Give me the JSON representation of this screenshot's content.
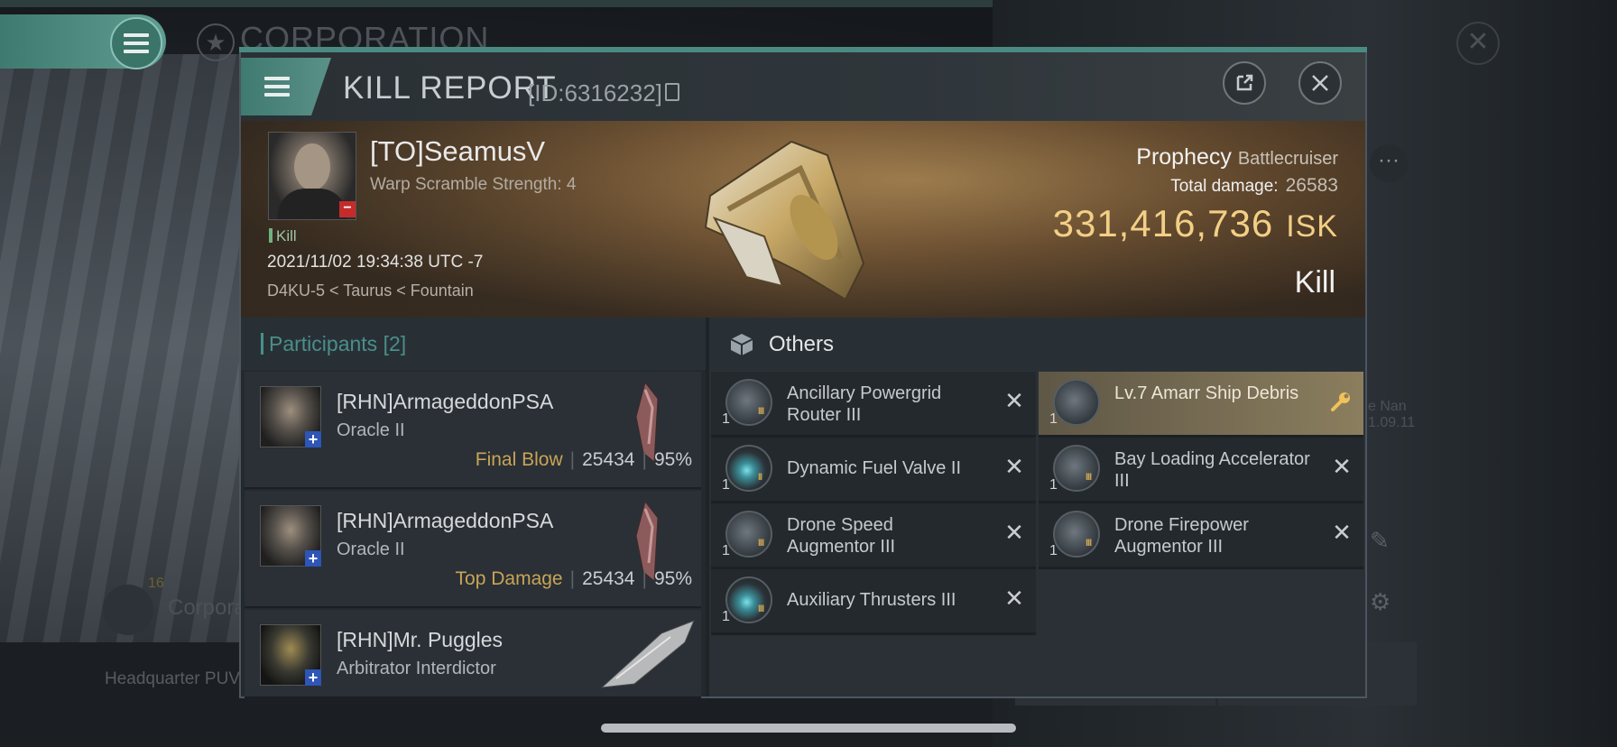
{
  "background": {
    "corp_title": "CORPORATION",
    "corp_small": "Corpora",
    "corp_count": "16",
    "bottom_text": "Headquarter PUV",
    "right_text_1": "e Nan",
    "right_text_2": "1.09.11"
  },
  "header": {
    "title": "KILL REPORT",
    "id_text": "[ID:6316232]",
    "icons": [
      "menu-icon",
      "external-link-icon",
      "close-icon",
      "copy-icon"
    ]
  },
  "victim": {
    "name": "[TO]SeamusV",
    "warp": "Warp Scramble Strength: 4",
    "kill_tag": "Kill",
    "datetime": "2021/11/02 19:34:38 UTC -7",
    "location": "D4KU-5 < Taurus < Fountain",
    "ship_name": "Prophecy",
    "ship_class": "Battlecruiser",
    "total_damage_label": "Total damage:",
    "total_damage": "26583",
    "isk_value": "331,416,736",
    "isk_unit": "ISK",
    "result": "Kill"
  },
  "participants": {
    "title": "Participants",
    "count": "[2]",
    "rows": [
      {
        "name": "[RHN]ArmageddonPSA",
        "ship": "Oracle II",
        "tag": "Final Blow",
        "damage": "25434",
        "pct": "95%"
      },
      {
        "name": "[RHN]ArmageddonPSA",
        "ship": "Oracle II",
        "tag": "Top Damage",
        "damage": "25434",
        "pct": "95%"
      },
      {
        "name": "[RHN]Mr. Puggles",
        "ship": "Arbitrator Interdictor"
      }
    ]
  },
  "others": {
    "title": "Others",
    "items": [
      {
        "name": "Ancillary Powergrid Router III",
        "qty": "1",
        "tier": "III"
      },
      {
        "name": "Dynamic Fuel Valve II",
        "qty": "1",
        "tier": "II"
      },
      {
        "name": "Drone Speed Augmentor III",
        "qty": "1",
        "tier": "III"
      },
      {
        "name": "Auxiliary Thrusters III",
        "qty": "1",
        "tier": "III"
      },
      {
        "name": "Lv.7 Amarr Ship Debris",
        "qty": "1"
      },
      {
        "name": "Bay Loading Accelerator III",
        "qty": "1",
        "tier": "III"
      },
      {
        "name": "Drone Firepower Augmentor III",
        "qty": "1",
        "tier": "III"
      }
    ]
  },
  "colors": {
    "accent": "#4a8a82",
    "isk": "#f3cf86",
    "tag_gold": "#c9a457",
    "highlight": "#8b7e5e"
  }
}
